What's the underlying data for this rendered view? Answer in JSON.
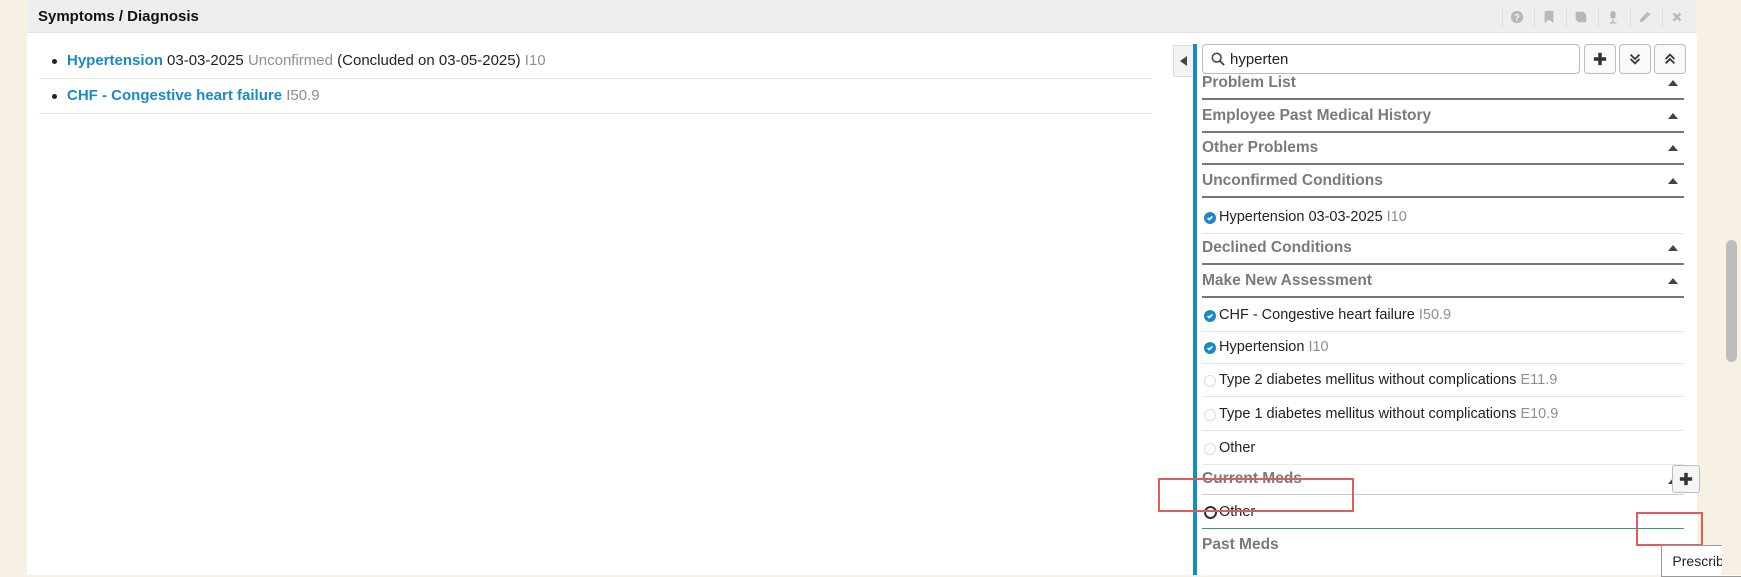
{
  "header": {
    "title": "Symptoms / Diagnosis",
    "icons": [
      "help-icon",
      "bookmark-icon",
      "book-icon",
      "mic-icon",
      "pencil-icon",
      "close-icon"
    ]
  },
  "diagnoses": [
    {
      "name": "Hypertension",
      "date": "03-03-2025",
      "status": "Unconfirmed",
      "note": "(Concluded on 03-05-2025)",
      "code": "I10"
    },
    {
      "name": "CHF - Congestive heart failure",
      "code": "I50.9"
    }
  ],
  "search": {
    "value": "hyperten",
    "placeholder": ""
  },
  "sections": {
    "problem_list": "Problem List",
    "employee_pmh": "Employee Past Medical History",
    "other_problems": "Other Problems",
    "unconfirmed": "Unconfirmed Conditions",
    "declined": "Declined Conditions",
    "new_assessment": "Make New Assessment",
    "current_meds": "Current Meds",
    "past_meds": "Past Meds"
  },
  "unconfirmed_items": [
    {
      "label": "Hypertension 03-03-2025",
      "code": "I10",
      "checked": true
    }
  ],
  "assessment_items": [
    {
      "label": "CHF - Congestive heart failure",
      "code": "I50.9",
      "checked": true
    },
    {
      "label": "Hypertension",
      "code": "I10",
      "checked": true
    },
    {
      "label": "Type 2 diabetes mellitus without complications",
      "code": "E11.9",
      "checked": false
    },
    {
      "label": "Type 1 diabetes mellitus without complications",
      "code": "E10.9",
      "checked": false
    },
    {
      "label": "Other",
      "code": "",
      "checked": false
    }
  ],
  "current_meds_items": [
    {
      "label": "Other"
    }
  ],
  "tooltip": "Prescribe",
  "colors": {
    "accent": "#1a8ac7",
    "highlight": "#e25b5b"
  }
}
